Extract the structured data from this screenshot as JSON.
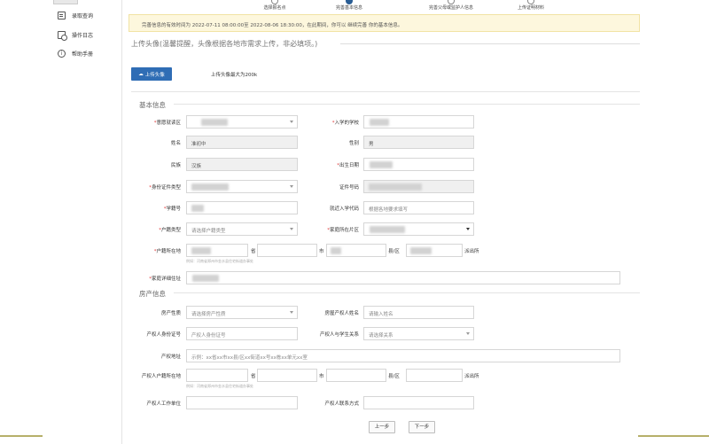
{
  "sidebar": {
    "items": [
      {
        "label": "录取查询",
        "icon": "doc-icon"
      },
      {
        "label": "操作日志",
        "icon": "log-icon"
      },
      {
        "label": "帮助手册",
        "icon": "info-icon"
      }
    ]
  },
  "steps": [
    {
      "label": "选择报名点",
      "active": false
    },
    {
      "label": "完善基本信息",
      "active": true
    },
    {
      "label": "完善父母或监护人信息",
      "active": false
    },
    {
      "label": "上传证明材料",
      "active": false
    }
  ],
  "notice": "完善信息的有效时间为 2022-07-11 08:00:00至 2022-08-06 18:30:00，在此期间，你可以 继续完善 你的基本信息。",
  "upload": {
    "title": "上传头像(温馨提醒，头像根据各地市需求上传，非必填项。)",
    "button": "上传头像",
    "hint": "上传头像最大为200k"
  },
  "basic": {
    "title": "基本信息",
    "fields": {
      "region": {
        "label": "意愿就读区"
      },
      "school": {
        "label": "入学的学校"
      },
      "name": {
        "label": "姓名",
        "value": "准初中"
      },
      "gender": {
        "label": "性别",
        "value": "男"
      },
      "nation": {
        "label": "民族",
        "value": "汉族"
      },
      "birth": {
        "label": "出生日期"
      },
      "idtype": {
        "label": "身份证件类型"
      },
      "idno": {
        "label": "证件号码"
      },
      "studentno": {
        "label": "学籍号"
      },
      "entrycode": {
        "label": "就近入学代码",
        "placeholder": "根据各地要求填写"
      },
      "hukoutype": {
        "label": "户籍类型",
        "placeholder": "请选择户籍类型"
      },
      "homeregion": {
        "label": "家庭所在片区"
      },
      "hukouloc": {
        "label": "户籍所在地",
        "province": "省",
        "city": "市",
        "county": "县/区",
        "street": "派出所",
        "hint": "例如：河南省郑州市金水县住宅街道办事处"
      },
      "address": {
        "label": "家庭详细住址"
      }
    }
  },
  "house": {
    "title": "房产信息",
    "fields": {
      "nature": {
        "label": "房产性质",
        "placeholder": "请选择房产性质"
      },
      "owner": {
        "label": "房屋产权人姓名",
        "placeholder": "请输入姓名"
      },
      "ownerid": {
        "label": "产权人身份证号",
        "placeholder": "产权人身份证号"
      },
      "relation": {
        "label": "产权人与学生关系",
        "placeholder": "请选择关系"
      },
      "houseaddr": {
        "label": "产权地址",
        "placeholder": "示例：xx省xx市xx县/区xx街道xx号xx栋xx单元xx室"
      },
      "ownerhukou": {
        "label": "产权人户籍所在地",
        "province": "省",
        "city": "市",
        "county": "县/区",
        "street": "派出所",
        "hint": "例如：河南省郑州市金水县住宅街道办事处"
      },
      "workunit": {
        "label": "产权人工作单位"
      },
      "contact": {
        "label": "产权人联系方式"
      }
    }
  },
  "nav": {
    "prev": "上一步",
    "next": "下一步"
  }
}
